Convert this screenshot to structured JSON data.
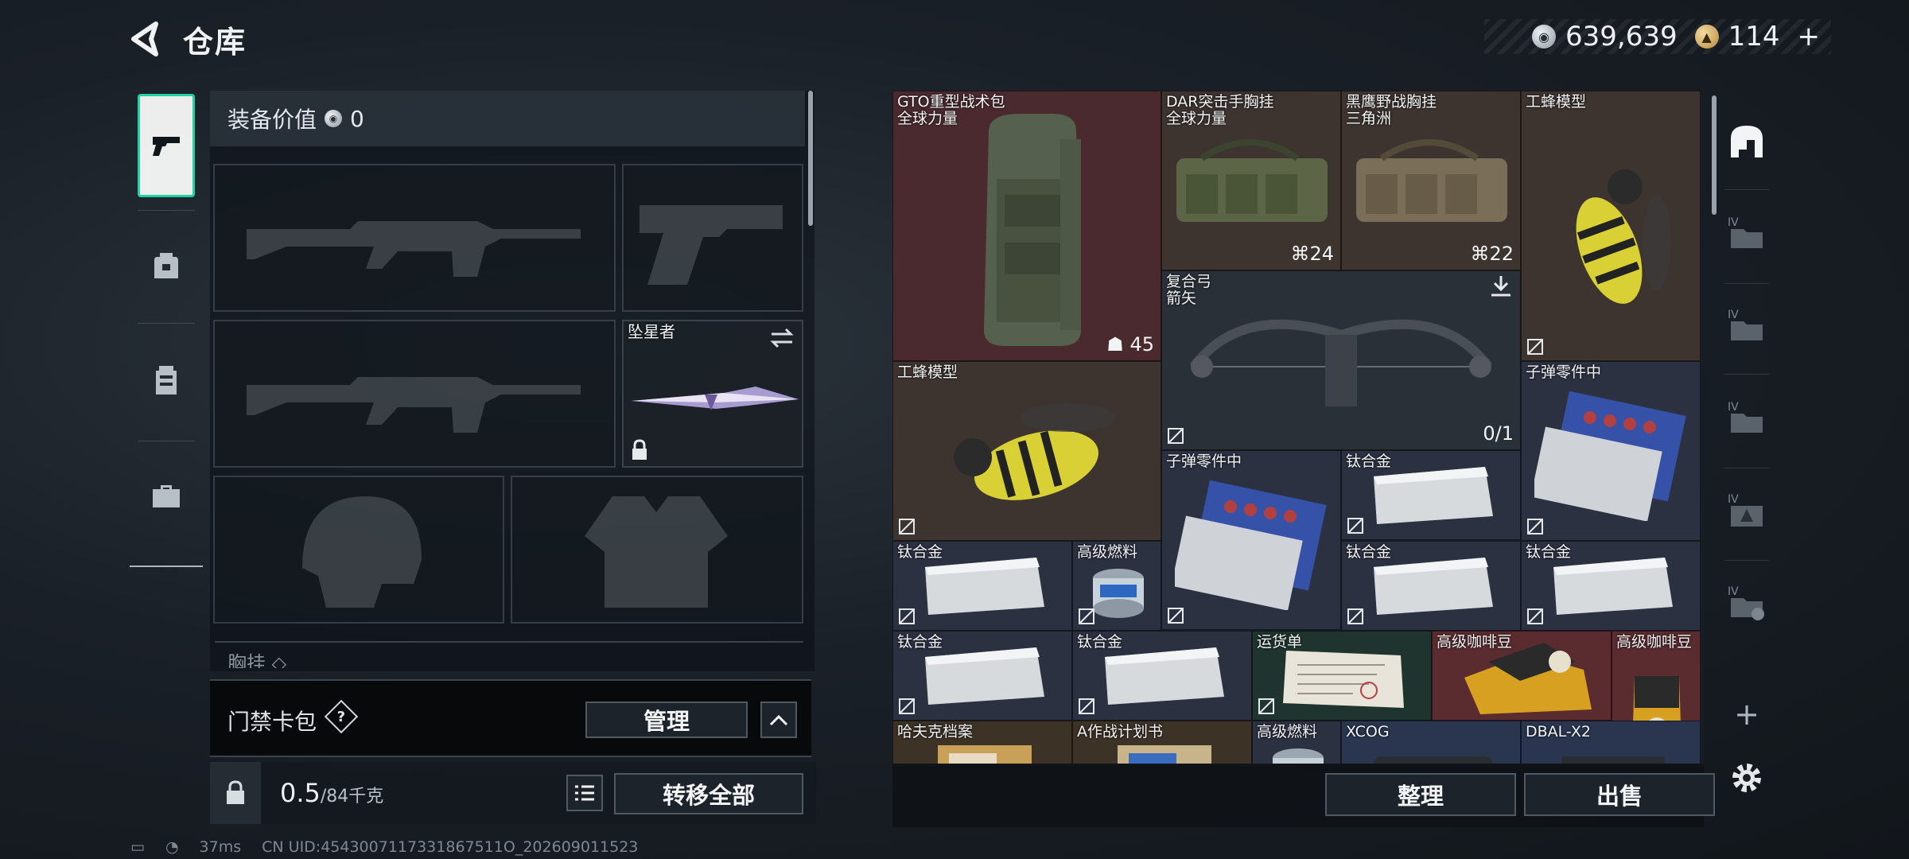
{
  "header": {
    "title": "仓库",
    "back_icon": "back-arrow-icon"
  },
  "currency": {
    "silver_amount": "639,639",
    "gold_amount": "114",
    "add_label": "+"
  },
  "left_nav": {
    "items": [
      {
        "icon": "pistol-icon",
        "active": true
      },
      {
        "icon": "backpack-icon",
        "active": false
      },
      {
        "icon": "vest-icon",
        "active": false
      },
      {
        "icon": "toolbox-icon",
        "active": false
      }
    ]
  },
  "equipment": {
    "value_label": "装备价值",
    "value": "0",
    "melee_name": "坠星者",
    "chest_label": "胸挂",
    "card_pack_label": "门禁卡包",
    "help_label": "?",
    "manage_label": "管理",
    "weight_value": "0.5",
    "weight_max": "/84千克",
    "transfer_all_label": "转移全部"
  },
  "storage": {
    "items": [
      {
        "name": "GTO重型战术包",
        "sub": "全球力量",
        "count": "45",
        "color": "red"
      },
      {
        "name": "DAR突击手胸挂",
        "sub": "全球力量",
        "count": "24",
        "color": "brown"
      },
      {
        "name": "黑鹰野战胸挂",
        "sub": "三角洲",
        "count": "22",
        "color": "brown"
      },
      {
        "name": "工蜂模型",
        "sub": "",
        "count": "",
        "color": "brown"
      },
      {
        "name": "复合弓",
        "sub": "箭矢",
        "count": "0/1",
        "color": "dark"
      },
      {
        "name": "工蜂模型",
        "sub": "",
        "count": "",
        "color": "brown"
      },
      {
        "name": "子弹零件中",
        "sub": "",
        "count": "",
        "color": "navy"
      },
      {
        "name": "子弹零件中",
        "sub": "",
        "count": "",
        "color": "navy"
      },
      {
        "name": "钛合金",
        "sub": "",
        "count": "",
        "color": "navy"
      },
      {
        "name": "钛合金",
        "sub": "",
        "count": "",
        "color": "navy"
      },
      {
        "name": "高级燃料",
        "sub": "",
        "count": "",
        "color": "navy"
      },
      {
        "name": "钛合金",
        "sub": "",
        "count": "",
        "color": "navy"
      },
      {
        "name": "钛合金",
        "sub": "",
        "count": "",
        "color": "navy"
      },
      {
        "name": "钛合金",
        "sub": "",
        "count": "",
        "color": "navy"
      },
      {
        "name": "钛合金",
        "sub": "",
        "count": "",
        "color": "navy"
      },
      {
        "name": "运货单",
        "sub": "",
        "count": "",
        "color": "green"
      },
      {
        "name": "高级咖啡豆",
        "sub": "",
        "count": "",
        "color": "crimson"
      },
      {
        "name": "高级咖啡豆",
        "sub": "",
        "count": "",
        "color": "crimson"
      },
      {
        "name": "哈夫克档案",
        "sub": "",
        "count": "",
        "color": "gold"
      },
      {
        "name": "A作战计划书",
        "sub": "",
        "count": "",
        "color": "gold"
      },
      {
        "name": "高级燃料",
        "sub": "",
        "count": "",
        "color": "navy"
      },
      {
        "name": "XCOG",
        "sub": "",
        "count": "",
        "color": "blue"
      },
      {
        "name": "DBAL-X2",
        "sub": "",
        "count": "",
        "color": "blue"
      }
    ],
    "sort_label": "整理",
    "sell_label": "出售"
  },
  "right_nav": {
    "items": [
      "safehouse-icon",
      "storage-iv-icon-1",
      "storage-iv-icon-2",
      "storage-iv-icon-3",
      "storage-iv-warning-icon",
      "storage-iv-lock-icon"
    ],
    "add_label": "+",
    "settings_icon": "gear-icon"
  },
  "status": {
    "ping": "37ms",
    "uid": "CN UID:4543007117331867511O_202609011523"
  },
  "colors": {
    "accent": "#1fd3a6",
    "red": "#4a2a2f",
    "brown": "#3d3430",
    "navy": "#2c3142",
    "green": "#1f342e",
    "crimson": "#5a2c30",
    "gold": "#3d3226",
    "blue": "#2a3650"
  }
}
